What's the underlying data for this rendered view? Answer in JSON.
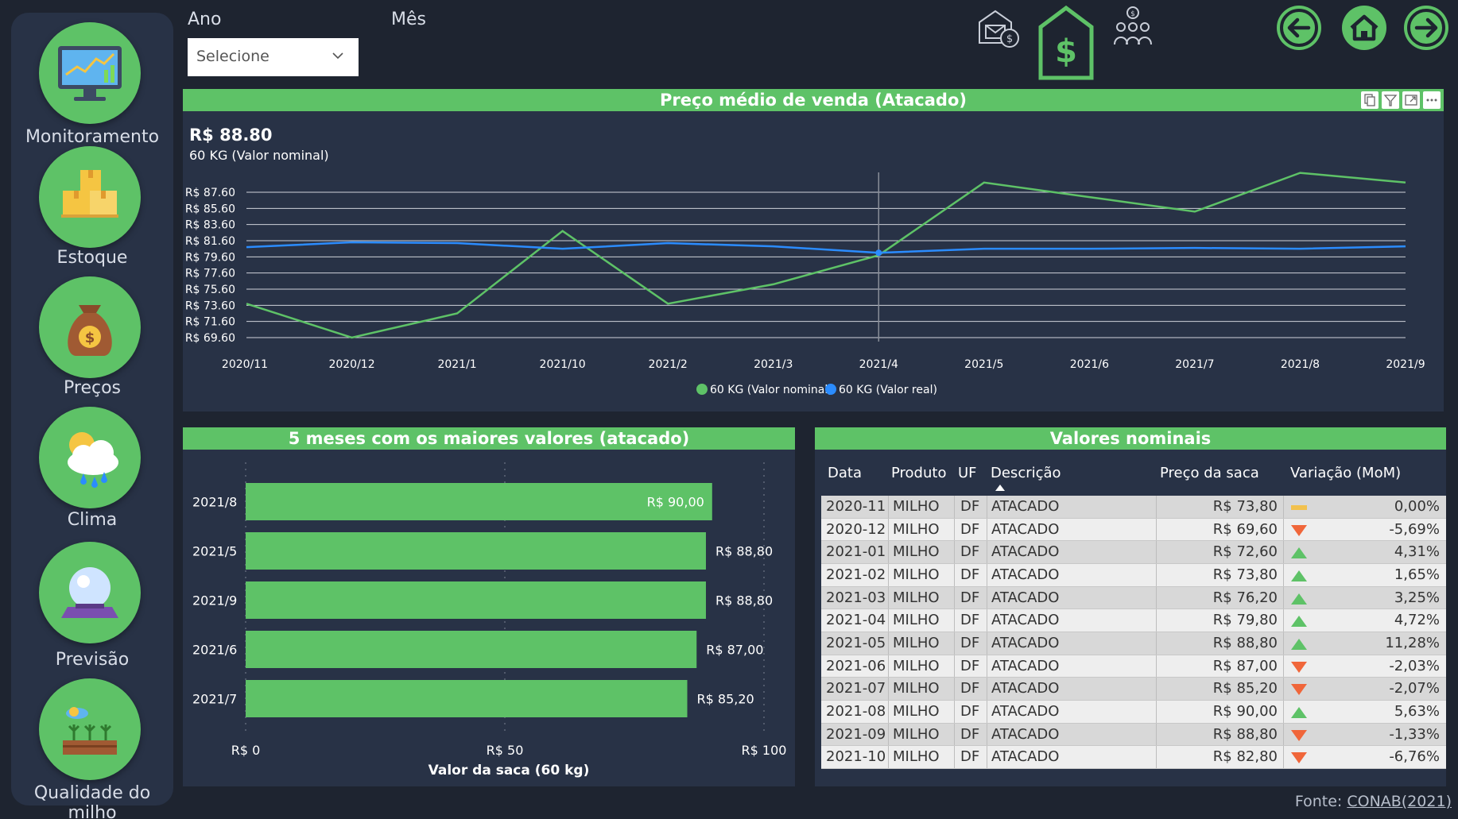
{
  "sidebar": {
    "items": [
      {
        "label": "Monitoramento",
        "icon": "monitor-chart-icon"
      },
      {
        "label": "Estoque",
        "icon": "boxes-icon"
      },
      {
        "label": "Preços",
        "icon": "money-bag-icon"
      },
      {
        "label": "Clima",
        "icon": "weather-cloud-icon"
      },
      {
        "label": "Previsão",
        "icon": "crystal-ball-icon"
      },
      {
        "label": "Qualidade do milho",
        "icon": "crop-field-icon"
      }
    ]
  },
  "filters": {
    "ano_label": "Ano",
    "mes_label": "Mês",
    "ano_placeholder": "Selecione"
  },
  "top_icons": [
    "warehouse-mail-icon",
    "price-house-icon",
    "investors-icon"
  ],
  "nav_arrows": [
    "arrow-left-icon",
    "home-icon",
    "arrow-right-icon"
  ],
  "colors": {
    "accent": "#5ec267",
    "panel": "#283246",
    "background": "#1e2430",
    "series_nominal": "#5ec267",
    "series_real": "#2b8cff",
    "up": "#5ec267",
    "down": "#f0663a",
    "flat": "#f2c14e"
  },
  "line_panel": {
    "title": "Preço médio de venda (Atacado)",
    "kpi_value": "R$ 88.80",
    "kpi_label": "60 KG (Valor nominal)"
  },
  "bar_panel": {
    "title": "5 meses com os maiores valores (atacado)"
  },
  "table_panel": {
    "title": "Valores nominais",
    "headers": [
      "Data",
      "Produto",
      "UF",
      "Descrição",
      "Preço da saca",
      "Variação (MoM)"
    ],
    "rows": [
      {
        "data": "2020-11",
        "produto": "MILHO",
        "uf": "DF",
        "descricao": "ATACADO",
        "preco": "R$ 73,80",
        "trend": "flat",
        "variacao": "0,00%"
      },
      {
        "data": "2020-12",
        "produto": "MILHO",
        "uf": "DF",
        "descricao": "ATACADO",
        "preco": "R$ 69,60",
        "trend": "down",
        "variacao": "-5,69%"
      },
      {
        "data": "2021-01",
        "produto": "MILHO",
        "uf": "DF",
        "descricao": "ATACADO",
        "preco": "R$ 72,60",
        "trend": "up",
        "variacao": "4,31%"
      },
      {
        "data": "2021-02",
        "produto": "MILHO",
        "uf": "DF",
        "descricao": "ATACADO",
        "preco": "R$ 73,80",
        "trend": "up",
        "variacao": "1,65%"
      },
      {
        "data": "2021-03",
        "produto": "MILHO",
        "uf": "DF",
        "descricao": "ATACADO",
        "preco": "R$ 76,20",
        "trend": "up",
        "variacao": "3,25%"
      },
      {
        "data": "2021-04",
        "produto": "MILHO",
        "uf": "DF",
        "descricao": "ATACADO",
        "preco": "R$ 79,80",
        "trend": "up",
        "variacao": "4,72%"
      },
      {
        "data": "2021-05",
        "produto": "MILHO",
        "uf": "DF",
        "descricao": "ATACADO",
        "preco": "R$ 88,80",
        "trend": "up",
        "variacao": "11,28%"
      },
      {
        "data": "2021-06",
        "produto": "MILHO",
        "uf": "DF",
        "descricao": "ATACADO",
        "preco": "R$ 87,00",
        "trend": "down",
        "variacao": "-2,03%"
      },
      {
        "data": "2021-07",
        "produto": "MILHO",
        "uf": "DF",
        "descricao": "ATACADO",
        "preco": "R$ 85,20",
        "trend": "down",
        "variacao": "-2,07%"
      },
      {
        "data": "2021-08",
        "produto": "MILHO",
        "uf": "DF",
        "descricao": "ATACADO",
        "preco": "R$ 90,00",
        "trend": "up",
        "variacao": "5,63%"
      },
      {
        "data": "2021-09",
        "produto": "MILHO",
        "uf": "DF",
        "descricao": "ATACADO",
        "preco": "R$ 88,80",
        "trend": "down",
        "variacao": "-1,33%"
      },
      {
        "data": "2021-10",
        "produto": "MILHO",
        "uf": "DF",
        "descricao": "ATACADO",
        "preco": "R$ 82,80",
        "trend": "down",
        "variacao": "-6,76%"
      }
    ]
  },
  "footer": {
    "source_prefix": "Fonte: ",
    "source_link": "CONAB(2021)"
  },
  "chart_data": [
    {
      "type": "line",
      "title": "Preço médio de venda (Atacado)",
      "categories": [
        "2020/11",
        "2020/12",
        "2021/1",
        "2021/10",
        "2021/2",
        "2021/3",
        "2021/4",
        "2021/5",
        "2021/6",
        "2021/7",
        "2021/8",
        "2021/9"
      ],
      "yticks": [
        "R$ 87.60",
        "R$ 85.60",
        "R$ 83.60",
        "R$ 81.60",
        "R$ 79.60",
        "R$ 77.60",
        "R$ 75.60",
        "R$ 73.60",
        "R$ 71.60",
        "R$ 69.60"
      ],
      "ylim": [
        69.6,
        87.6
      ],
      "series": [
        {
          "name": "60 KG (Valor nominal)",
          "values": [
            73.8,
            69.6,
            72.6,
            82.8,
            73.8,
            76.2,
            79.8,
            88.8,
            87.0,
            85.2,
            90.0,
            88.8
          ]
        },
        {
          "name": "60 KG (Valor real)",
          "values": [
            80.8,
            81.4,
            81.3,
            80.6,
            81.3,
            80.9,
            80.1,
            80.6,
            80.6,
            80.7,
            80.6,
            80.9
          ]
        }
      ],
      "grid": true,
      "legend": "bottom-center"
    },
    {
      "type": "bar",
      "orientation": "horizontal",
      "title": "5 meses com os maiores valores (atacado)",
      "categories": [
        "2021/8",
        "2021/5",
        "2021/9",
        "2021/6",
        "2021/7"
      ],
      "values": [
        90.0,
        88.8,
        88.8,
        87.0,
        85.2
      ],
      "value_labels": [
        "R$ 90,00",
        "R$ 88,80",
        "R$ 88,80",
        "R$ 87,00",
        "R$ 85,20"
      ],
      "xticks": [
        "R$ 0",
        "R$ 50",
        "R$ 100"
      ],
      "xlim": [
        0,
        100
      ],
      "xlabel": "Valor da saca (60 kg)"
    }
  ]
}
